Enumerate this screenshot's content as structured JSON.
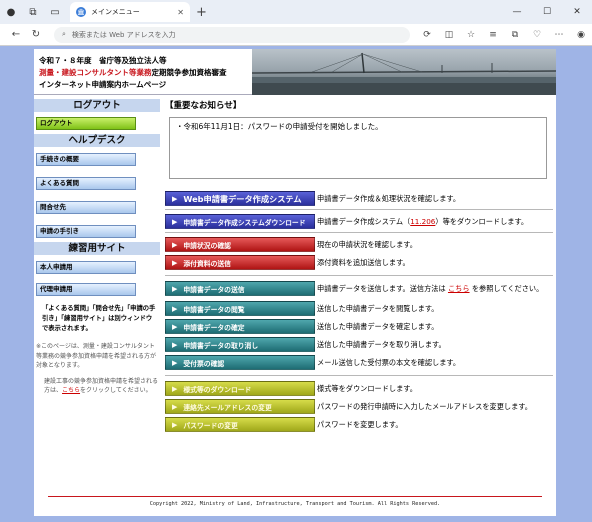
{
  "browser": {
    "tab_title": "メインメニュー",
    "tab_favicon": "🏛",
    "url_placeholder": "検索または Web アドレスを入力",
    "window_controls": [
      "—",
      "☐",
      "✕"
    ]
  },
  "header": {
    "line1": "令和７・８年度　省庁等及独立法人等",
    "line2_red": "測量・建設コンサルタント等業務",
    "line2_rest": "定期競争参加資格審査",
    "line3": "インターネット申請案内ホームページ"
  },
  "left": {
    "logout_head": "ログアウト",
    "logout_btn": "ログアウト",
    "helpdesk_head": "ヘルプデスク",
    "help_items": [
      "手続きの概要",
      "よくある質問",
      "問合せ先",
      "申請の手引き"
    ],
    "practice_head": "練習用サイト",
    "practice_items": [
      "本人申請用",
      "代理申請用"
    ],
    "note": "「よくある質問」「問合せ先」「申請の手引き」「練習用サイト」は別ウィンドウで表示されます。",
    "small1": "※このページは、測量・建設コンサルタント等業務の競争参加資格申請を希望される方が対象となります。",
    "small2_pre": "建設工事の競争参加資格申請を希望される方は、",
    "small2_link": "こちら",
    "small2_post": "をクリックしてください。"
  },
  "notice": {
    "title": "【重要なお知らせ】",
    "items": [
      "・令和6年11月1日：パスワードの申請受付を開始しました。"
    ]
  },
  "menu": [
    {
      "label": "Web申請書データ作成システム",
      "desc": "申請書データ作成＆処理状況を確認します。"
    },
    {
      "label": "申請書データ作成システムダウンロード",
      "desc_pre": "申請書データ作成システム（",
      "desc_link": "11.206",
      "desc_post": "）等をダウンロードします。"
    },
    {
      "label": "申請状況の確認",
      "desc": "現在の申請状況を確認します。"
    },
    {
      "label": "添付資料の送信",
      "desc": "添付資料を追加送信します。"
    },
    {
      "label": "申請書データの送信",
      "desc_pre": "申請書データを送信します。送信方法は ",
      "desc_link": "こちら",
      "desc_post": " を参照してください。"
    },
    {
      "label": "申請書データの閲覧",
      "desc": "送信した申請書データを閲覧します。"
    },
    {
      "label": "申請書データの確定",
      "desc": "送信した申請書データを確定します。"
    },
    {
      "label": "申請書データの取り消し",
      "desc": "送信した申請書データを取り消します。"
    },
    {
      "label": "受付票の確認",
      "desc": "メール送信した受付票の本文を確認します。"
    },
    {
      "label": "様式等のダウンロード",
      "desc": "様式等をダウンロードします。"
    },
    {
      "label": "連絡先メールアドレスの変更",
      "desc": "パスワードの発行申請時に入力したメールアドレスを変更します。"
    },
    {
      "label": "パスワードの変更",
      "desc": "パスワードを変更します。"
    }
  ],
  "footer": "Copyright 2022, Ministry of Land, Infrastructure, Transport and Tourism. All Rights Reserved."
}
